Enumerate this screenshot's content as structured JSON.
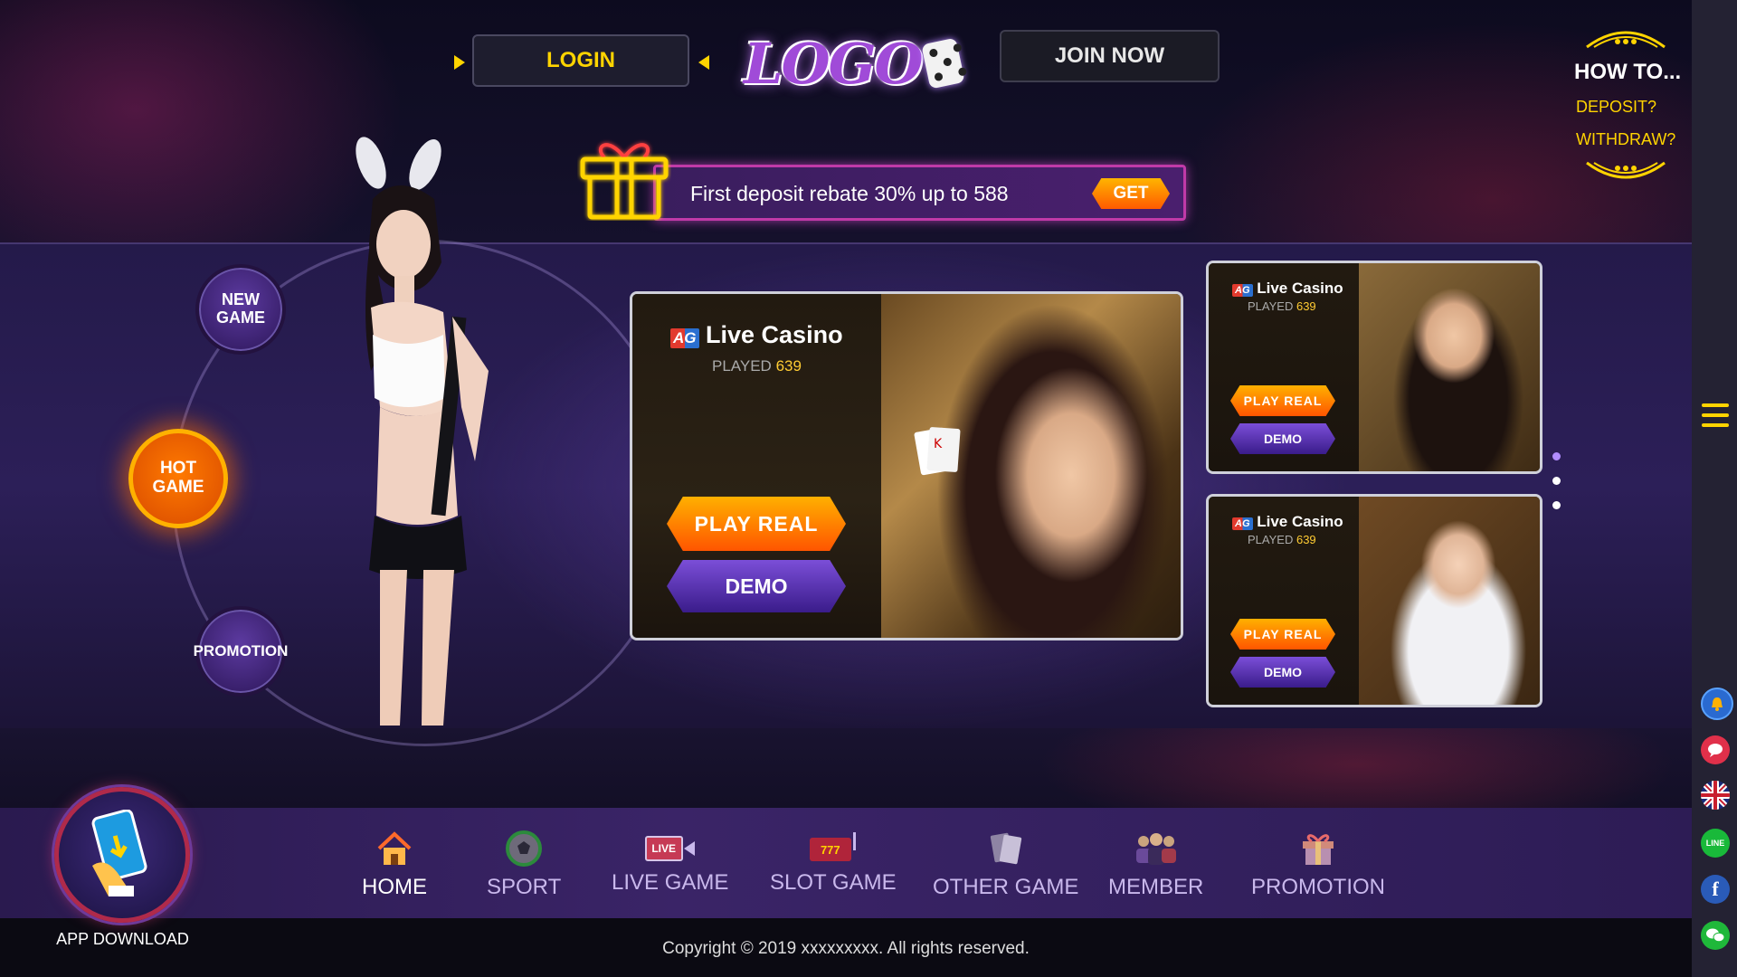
{
  "header": {
    "login_label": "LOGIN",
    "logo_text": "LOGO",
    "join_label": "JOIN NOW"
  },
  "howto": {
    "title": "HOW TO...",
    "deposit": "DEPOSIT?",
    "withdraw": "WITHDRAW?"
  },
  "promo": {
    "text": "First deposit rebate 30% up to 588",
    "get_label": "GET"
  },
  "ring_menu": {
    "new_game": "NEW GAME",
    "hot_game": "HOT GAME",
    "promotion": "PROMOTION"
  },
  "cards": [
    {
      "provider": "AG",
      "title": "Live Casino",
      "played_label": "PLAYED",
      "played_count": "639",
      "play_label": "PLAY REAL",
      "demo_label": "DEMO"
    },
    {
      "provider": "AG",
      "title": "Live Casino",
      "played_label": "PLAYED",
      "played_count": "639",
      "play_label": "PLAY REAL",
      "demo_label": "DEMO"
    },
    {
      "provider": "AG",
      "title": "Live Casino",
      "played_label": "PLAYED",
      "played_count": "639",
      "play_label": "PLAY REAL",
      "demo_label": "DEMO"
    }
  ],
  "carousel": {
    "pages": 3,
    "active": 1
  },
  "app_download": "APP DOWNLOAD",
  "nav": [
    {
      "label": "HOME",
      "icon": "home-icon",
      "active": true
    },
    {
      "label": "SPORT",
      "icon": "soccer-ball-icon"
    },
    {
      "label": "LIVE GAME",
      "icon": "live-camera-icon",
      "badge": "LIVE"
    },
    {
      "label": "SLOT GAME",
      "icon": "slot-machine-icon",
      "badge": "777"
    },
    {
      "label": "OTHER GAME",
      "icon": "playing-cards-icon"
    },
    {
      "label": "MEMBER",
      "icon": "members-icon"
    },
    {
      "label": "PROMOTION",
      "icon": "gift-icon"
    }
  ],
  "footer": {
    "copyright": "Copyright © 2019 xxxxxxxxx. All rights reserved."
  },
  "side_icons": [
    "bell-icon",
    "chat-icon",
    "uk-flag-icon",
    "line-icon",
    "facebook-icon",
    "wechat-icon"
  ],
  "side_icon_text": {
    "line": "LINE",
    "facebook": "f"
  },
  "colors": {
    "accent": "#ffd400",
    "orange": "#ff6a00",
    "purple": "#5a2fb0"
  }
}
